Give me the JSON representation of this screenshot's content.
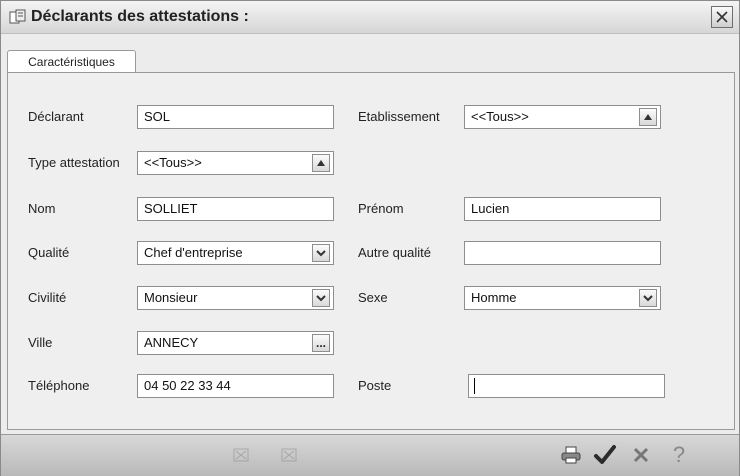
{
  "window": {
    "title": "Déclarants des attestations :",
    "close_glyph": "✕"
  },
  "tabs": [
    {
      "label": "Caractéristiques"
    }
  ],
  "form": {
    "declarant": {
      "label": "Déclarant",
      "value": "SOL"
    },
    "etablissement": {
      "label": "Etablissement",
      "value": "<<Tous>>"
    },
    "type_attestation": {
      "label": "Type attestation",
      "value": "<<Tous>>"
    },
    "nom": {
      "label": "Nom",
      "value": "SOLLIET"
    },
    "prenom": {
      "label": "Prénom",
      "value": "Lucien"
    },
    "qualite": {
      "label": "Qualité",
      "value": "Chef d'entreprise"
    },
    "autre_qualite": {
      "label": "Autre qualité",
      "value": ""
    },
    "civilite": {
      "label": "Civilité",
      "value": "Monsieur"
    },
    "sexe": {
      "label": "Sexe",
      "value": "Homme"
    },
    "ville": {
      "label": "Ville",
      "value": "ANNECY",
      "button": "..."
    },
    "telephone": {
      "label": "Téléphone",
      "value": "04 50 22 33 44"
    },
    "poste": {
      "label": "Poste",
      "value": ""
    }
  },
  "footer": {
    "icons": [
      "nav-prev-icon",
      "nav-next-icon",
      "print-icon",
      "validate-check-icon",
      "cancel-x-icon",
      "help-icon"
    ],
    "help_glyph": "?"
  }
}
